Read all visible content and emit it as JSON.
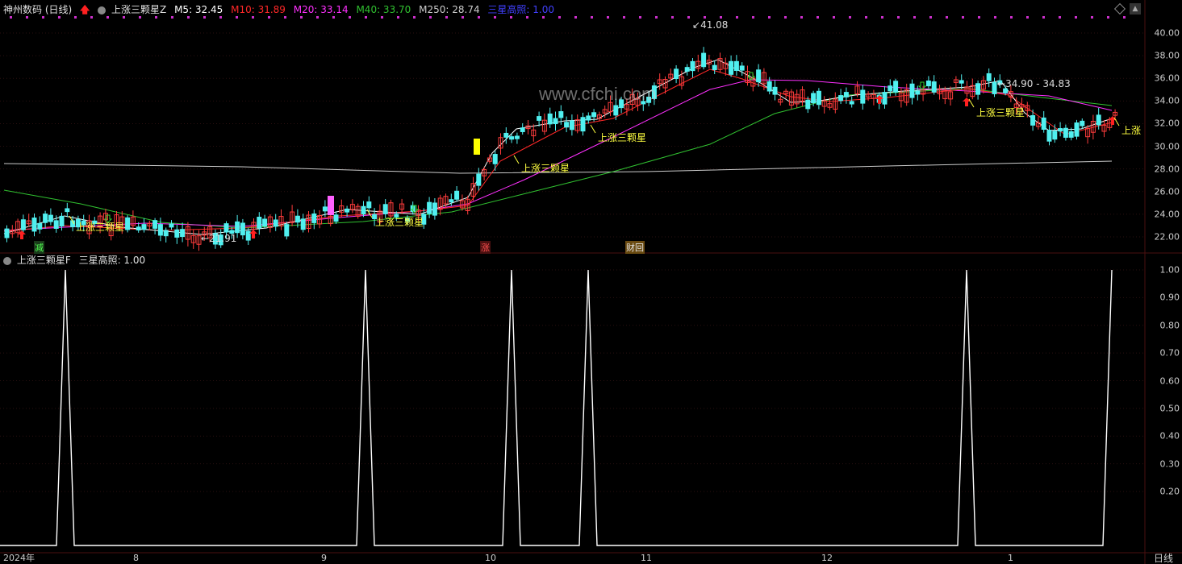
{
  "header_main": {
    "stock_name": "神州数码 (日线)",
    "indicator": "上涨三颗星Z",
    "ma5": "M5: 32.45",
    "ma10": "M10: 31.89",
    "ma20": "M20: 33.14",
    "ma40": "M40: 33.70",
    "ma250": "M250: 28.74",
    "star": "三星高照: 1.00"
  },
  "header_sub": {
    "indicator": "上涨三颗星F",
    "value": "三星高照: 1.00"
  },
  "colors": {
    "ma5": "#ffffff",
    "ma10": "#ff2828",
    "ma20": "#ff30ff",
    "ma40": "#30c030",
    "ma250": "#cccccc",
    "star": "#4040ff",
    "up": "#ff3c3c",
    "down": "#50f0f0",
    "signal": "#ffff40",
    "dots": "#cc30cc"
  },
  "price_axis": [
    "40.00",
    "38.00",
    "36.00",
    "34.00",
    "32.00",
    "30.00",
    "28.00",
    "26.00",
    "24.00",
    "22.00"
  ],
  "sub_axis": [
    "1.00",
    "0.90",
    "0.80",
    "0.70",
    "0.60",
    "0.50",
    "0.40",
    "0.30",
    "0.20"
  ],
  "date_axis": [
    "2024年",
    "8",
    "9",
    "10",
    "11",
    "12",
    "1"
  ],
  "period_label": "日线",
  "annotations": {
    "high": "41.08",
    "low": "21.91",
    "range": "34.90 - 34.83",
    "star_label": "上涨三颗星",
    "star_label_cut": "上涨",
    "tag_jian": "减",
    "tag_zhang": "涨",
    "tag_cai": "财回",
    "watermark": "www.cfchi.com"
  },
  "chart_data": {
    "type": "line",
    "series": [
      {
        "name": "三星高照",
        "values": [
          0,
          1,
          0,
          0,
          1,
          0,
          1,
          0,
          1,
          0,
          1,
          0,
          1
        ]
      }
    ],
    "ylim": [
      0,
      1
    ]
  }
}
